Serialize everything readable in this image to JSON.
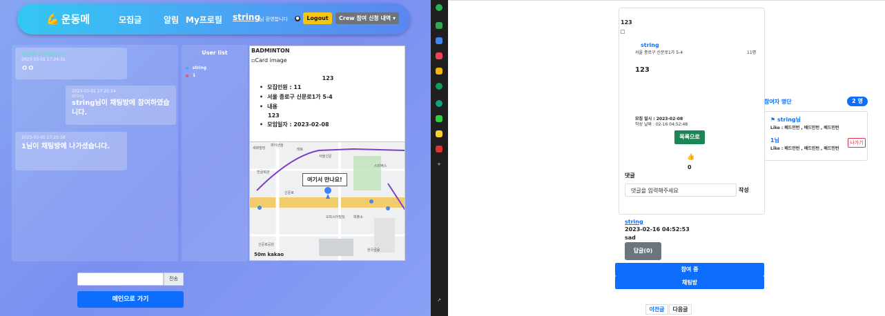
{
  "nav": {
    "logo": "운동메",
    "posts": "모집글",
    "alarm": "알림",
    "profile": "My프로필",
    "username": "string",
    "greeting": "님 환영합니다",
    "logout": "Logout",
    "crew": "Crew 참여 신청 내역 ▾"
  },
  "chat": {
    "messages": [
      {
        "name": "채팅방에 참여하셨습니다",
        "time": "2023-03-01 17:24:31",
        "text": "ㅇㅇ"
      },
      {
        "name": "string",
        "time": "2023-03-01 17:25:54",
        "text": "string님이 채팅방에 참여하였습니다."
      },
      {
        "name": "",
        "time": "2023-03-01 17:25:58",
        "text": "1님이 채팅방에 나가셨습니다."
      }
    ],
    "send": "전송",
    "main_button": "메인으로 가기"
  },
  "users": {
    "title": "User list",
    "list": [
      {
        "name": "string",
        "color": "#4aa3f4"
      },
      {
        "name": "1",
        "color": "#e05a5a"
      }
    ]
  },
  "card": {
    "sport": "BADMINTON",
    "image_alt": "Card image",
    "title": "123",
    "recruit": "모집인원 : 11",
    "address": "서울 종로구 신문로1가 5-4",
    "content_label": "내용",
    "content": "123",
    "date": "모임일자 : 2023-02-08"
  },
  "map": {
    "meet_label": "여기서 만나요!",
    "scale": "50m",
    "brand": "kakao",
    "labels": [
      "파이낸셜",
      "테토",
      "서울신문",
      "스타벅스",
      "한글회관",
      "여기서 만나요",
      "광화문",
      "내수동",
      "신문로",
      "오피시아빌딩",
      "세종로",
      "파출소",
      "신문로공원",
      "필동",
      "한국금융",
      "SK텔레콤"
    ]
  },
  "sidebar": {
    "icons": [
      "chrome-icon",
      "bell-icon",
      "mail-icon",
      "pocket-icon",
      "star-icon",
      "edge-icon",
      "gpt-icon",
      "chat-icon",
      "note-icon",
      "news-icon",
      "plus-icon",
      "external-icon"
    ]
  },
  "post": {
    "title": "123",
    "user": "string",
    "address": "서울 종로구 신문로1가 5-4",
    "count": "11명",
    "content": "123",
    "meet_date": "모집 일시 : 2023-02-08",
    "created": "작성 날짜 : 02-16 04:52:48",
    "list_button": "목록으로",
    "likes": "0",
    "comment_header": "댓글",
    "comment_placeholder": "댓글을 입력해주세요",
    "comment_submit": "작성",
    "comment_user": "string",
    "comment_date": "2023-02-16 04:52:53",
    "comment_text": "sad",
    "reply_button": "답글(0)",
    "joined_button": "참여 중",
    "chatroom_button": "채팅방",
    "prev": "이전글",
    "next": "다음글"
  },
  "participants": {
    "header": "참여자 명단",
    "badge": "2 명",
    "list": [
      {
        "name": "⚑ string님",
        "like": "Like : 배드민턴 , 배드민턴 , 배드민턴"
      },
      {
        "name": "1님",
        "like": "Like : 배드민턴 , 배드민턴 , 배드민턴"
      }
    ],
    "leave": "나가기"
  },
  "colors": {
    "primary": "#0d6efd",
    "success": "#198754",
    "warning": "#f8c513",
    "secondary": "#6c757d",
    "danger": "#dc3545"
  }
}
